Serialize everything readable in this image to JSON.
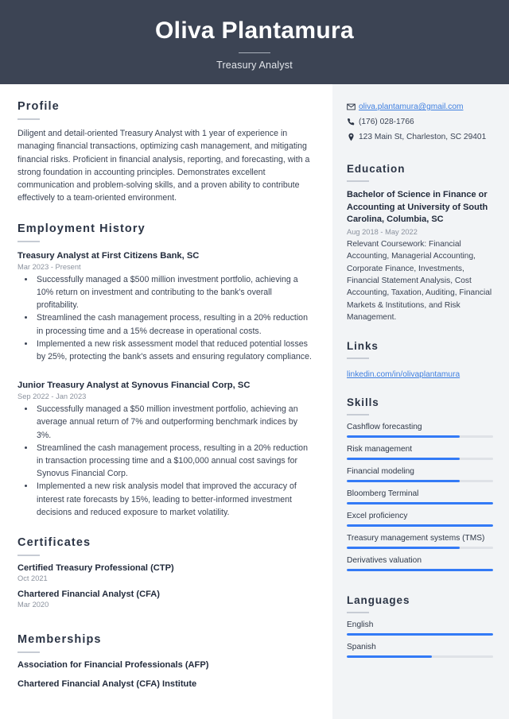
{
  "header": {
    "name": "Oliva Plantamura",
    "job_title": "Treasury Analyst",
    "bg_color": "#3c4454"
  },
  "theme": {
    "accent": "#337af6",
    "link": "#3f7fe0",
    "sidebar_bg": "#f2f4f6",
    "heading": "#2b3445",
    "muted": "#8b929e"
  },
  "main": {
    "profile": {
      "heading": "Profile",
      "text": "Diligent and detail-oriented Treasury Analyst with 1 year of experience in managing financial transactions, optimizing cash management, and mitigating financial risks. Proficient in financial analysis, reporting, and forecasting, with a strong foundation in accounting principles. Demonstrates excellent communication and problem-solving skills, and a proven ability to contribute effectively to a team-oriented environment."
    },
    "employment": {
      "heading": "Employment History",
      "jobs": [
        {
          "title": "Treasury Analyst at First Citizens Bank, SC",
          "date": "Mar 2023 - Present",
          "bullets": [
            "Successfully managed a $500 million investment portfolio, achieving a 10% return on investment and contributing to the bank's overall profitability.",
            "Streamlined the cash management process, resulting in a 20% reduction in processing time and a 15% decrease in operational costs.",
            "Implemented a new risk assessment model that reduced potential losses by 25%, protecting the bank's assets and ensuring regulatory compliance."
          ]
        },
        {
          "title": "Junior Treasury Analyst at Synovus Financial Corp, SC",
          "date": "Sep 2022 - Jan 2023",
          "bullets": [
            "Successfully managed a $50 million investment portfolio, achieving an average annual return of 7% and outperforming benchmark indices by 3%.",
            "Streamlined the cash management process, resulting in a 20% reduction in transaction processing time and a $100,000 annual cost savings for Synovus Financial Corp.",
            "Implemented a new risk analysis model that improved the accuracy of interest rate forecasts by 15%, leading to better-informed investment decisions and reduced exposure to market volatility."
          ]
        }
      ]
    },
    "certificates": {
      "heading": "Certificates",
      "items": [
        {
          "title": "Certified Treasury Professional (CTP)",
          "date": "Oct 2021"
        },
        {
          "title": "Chartered Financial Analyst (CFA)",
          "date": "Mar 2020"
        }
      ]
    },
    "memberships": {
      "heading": "Memberships",
      "items": [
        "Association for Financial Professionals (AFP)",
        "Chartered Financial Analyst (CFA) Institute"
      ]
    }
  },
  "sidebar": {
    "contact": [
      {
        "icon": "email-icon",
        "value": "oliva.plantamura@gmail.com",
        "is_link": true
      },
      {
        "icon": "phone-icon",
        "value": "(176) 028-1766",
        "is_link": false
      },
      {
        "icon": "location-pin-icon",
        "value": "123 Main St, Charleston, SC 29401",
        "is_link": false
      }
    ],
    "education": {
      "heading": "Education",
      "degree": "Bachelor of Science in Finance or Accounting at University of South Carolina, Columbia, SC",
      "date": "Aug 2018 - May 2022",
      "description": "Relevant Coursework: Financial Accounting, Managerial Accounting, Corporate Finance, Investments, Financial Statement Analysis, Cost Accounting, Taxation, Auditing, Financial Markets & Institutions, and Risk Management."
    },
    "links": {
      "heading": "Links",
      "items": [
        "linkedin.com/in/olivaplantamura"
      ]
    },
    "skills": {
      "heading": "Skills",
      "items": [
        {
          "label": "Cashflow forecasting",
          "level": 77
        },
        {
          "label": "Risk management",
          "level": 77
        },
        {
          "label": "Financial modeling",
          "level": 77
        },
        {
          "label": "Bloomberg Terminal",
          "level": 100
        },
        {
          "label": "Excel proficiency",
          "level": 100
        },
        {
          "label": "Treasury management systems (TMS)",
          "level": 77
        },
        {
          "label": "Derivatives valuation",
          "level": 100
        }
      ]
    },
    "languages": {
      "heading": "Languages",
      "items": [
        {
          "label": "English",
          "level": 100
        },
        {
          "label": "Spanish",
          "level": 58
        }
      ]
    }
  }
}
